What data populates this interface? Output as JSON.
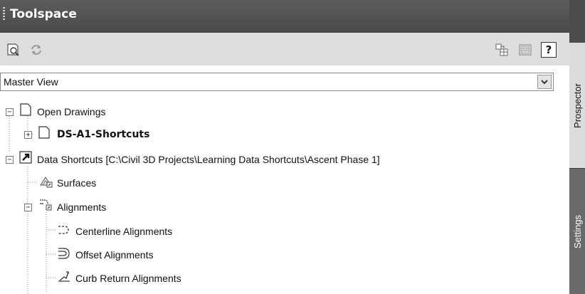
{
  "panel": {
    "title": "Toolspace"
  },
  "tabs": {
    "prospector": "Prospector",
    "settings": "Settings"
  },
  "toolbar": {
    "items": [
      {
        "name": "activate-drawing-icon"
      },
      {
        "name": "refresh-icon"
      },
      {
        "name": "toggle-item-view-icon"
      },
      {
        "name": "toggle-list-view-icon"
      },
      {
        "name": "help-icon",
        "label": "?"
      }
    ]
  },
  "view_selector": {
    "value": "Master View"
  },
  "tree": {
    "open_drawings": "Open Drawings",
    "drawing": "DS-A1-Shortcuts",
    "data_shortcuts": "Data Shortcuts [C:\\Civil 3D Projects\\Learning Data Shortcuts\\Ascent Phase 1]",
    "surfaces": "Surfaces",
    "alignments": "Alignments",
    "centerline_alignments": "Centerline Alignments",
    "offset_alignments": "Offset Alignments",
    "curb_return_alignments": "Curb Return Alignments"
  }
}
